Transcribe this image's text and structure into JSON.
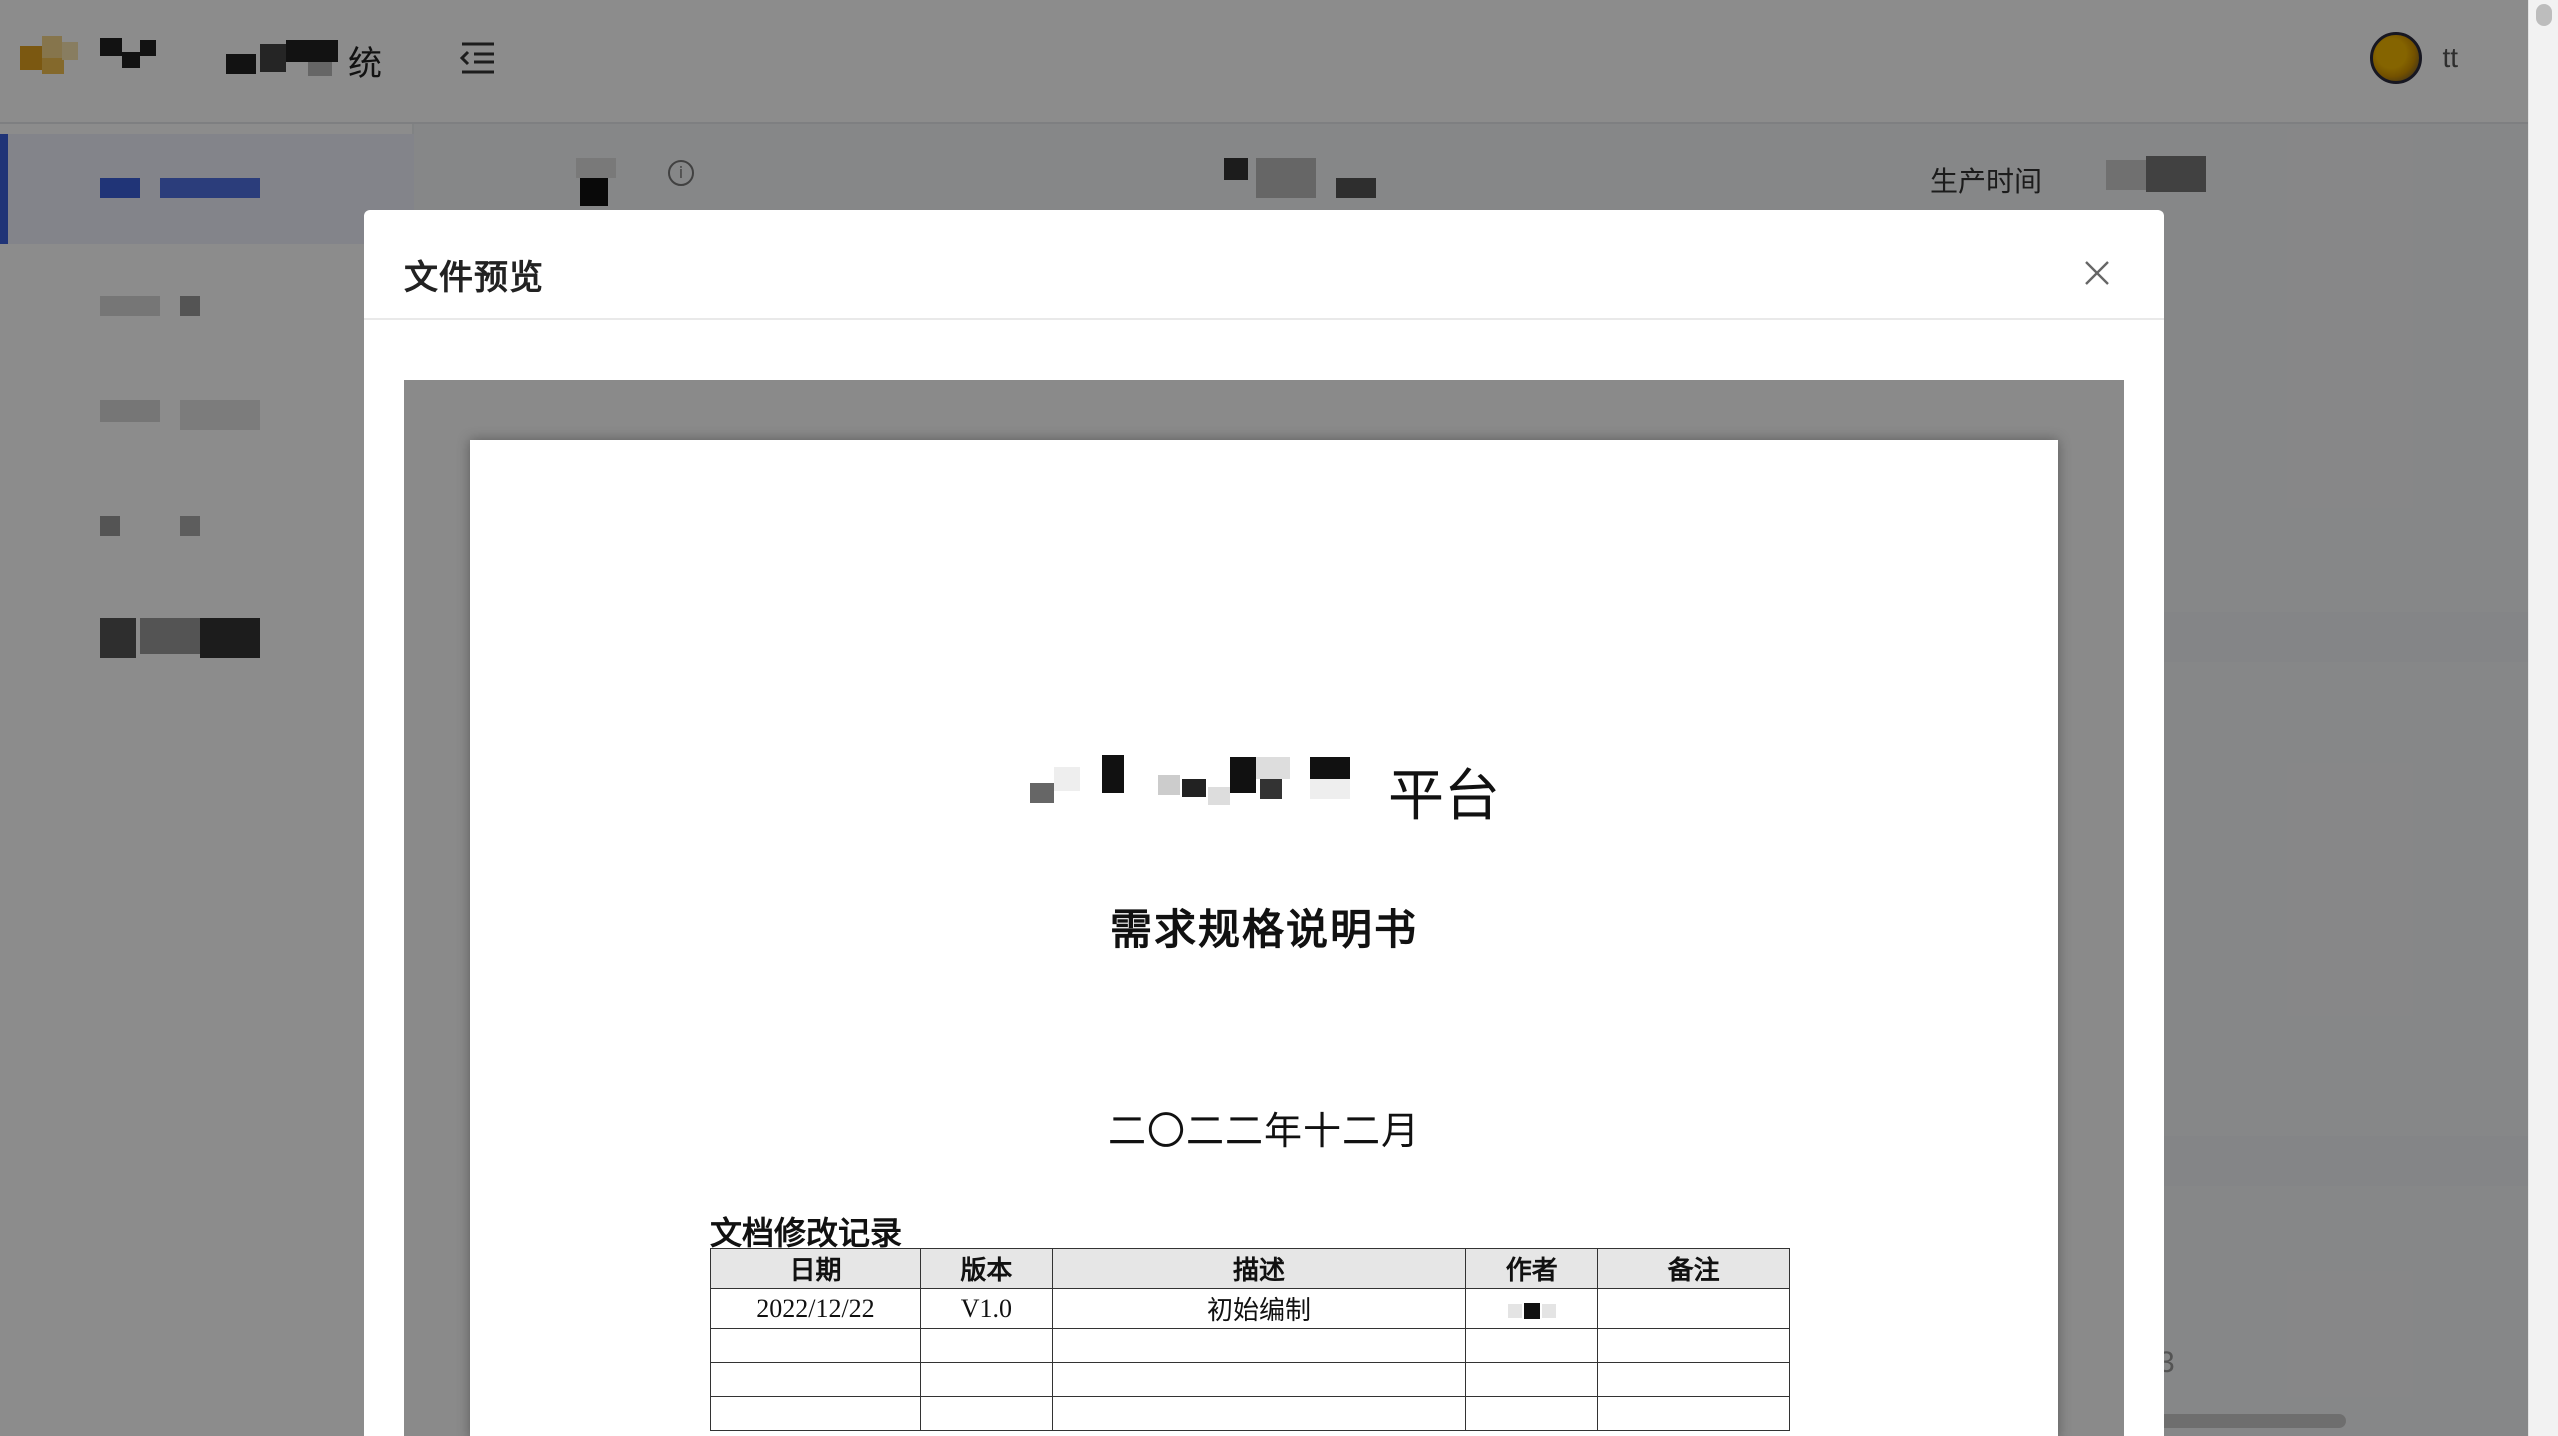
{
  "app": {
    "system_title_suffix": "统",
    "username": "tt",
    "info_icon_glyph": "i",
    "production_time_label": "生产时间",
    "pager_fragment": "3",
    "accent_color": "#3b5fd9"
  },
  "modal": {
    "title": "文件预览",
    "close_glyph": "×"
  },
  "document": {
    "title_suffix": "平台",
    "subtitle": "需求规格说明书",
    "date": "二〇二二年十二月",
    "revision_caption": "文档修改记录",
    "revision_table": {
      "headers": [
        "日期",
        "版本",
        "描述",
        "作者",
        "备注"
      ],
      "rows": [
        [
          "2022/12/22",
          "V1.0",
          "初始编制",
          "",
          ""
        ],
        [
          "",
          "",
          "",
          "",
          ""
        ],
        [
          "",
          "",
          "",
          "",
          ""
        ],
        [
          "",
          "",
          "",
          "",
          ""
        ]
      ]
    }
  }
}
